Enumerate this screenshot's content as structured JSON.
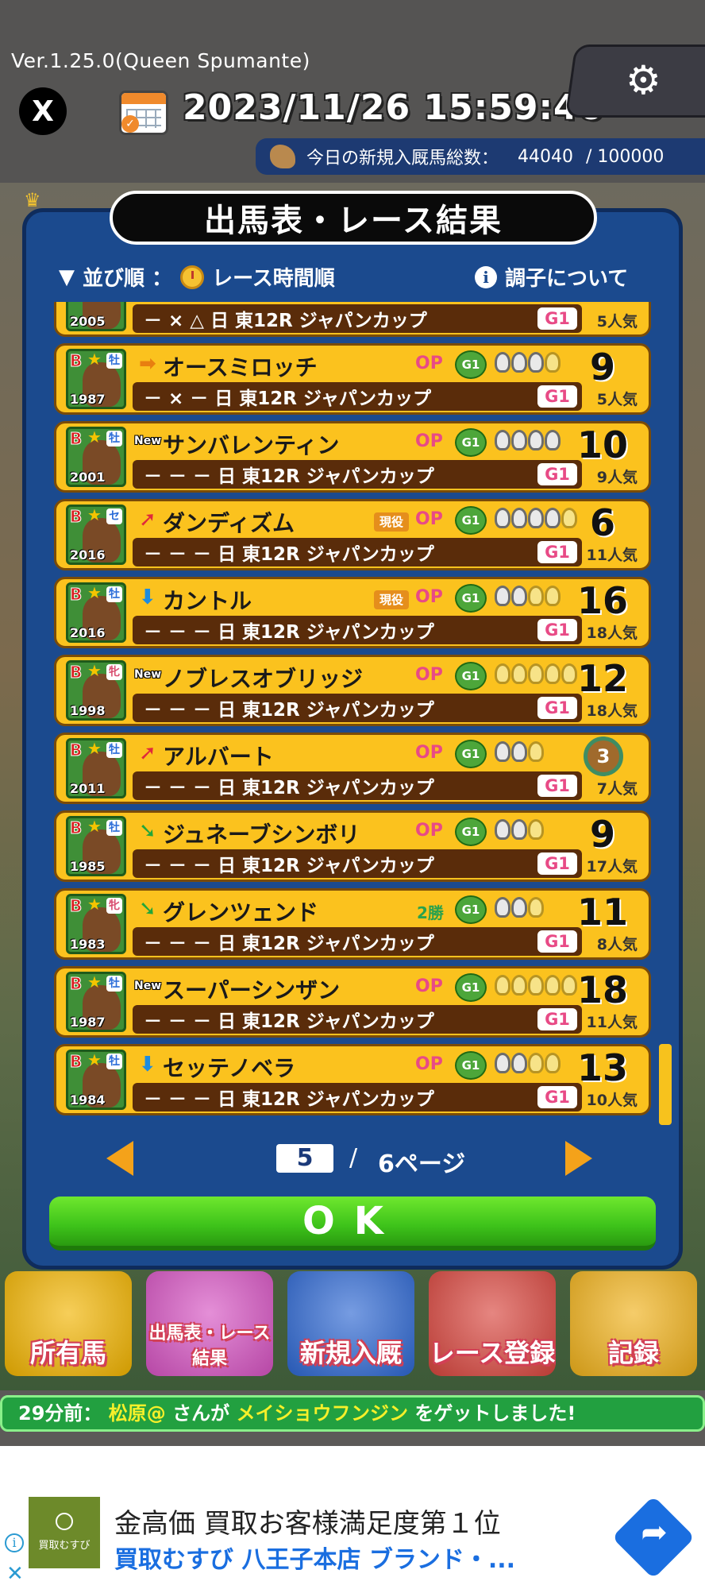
{
  "header": {
    "version": "Ver.1.25.0(Queen Spumante)",
    "x_logo": "X",
    "datetime": "2023/11/26 15:59:46",
    "new_horses_label": "今日の新規入厩馬総数：",
    "new_horses_count": "44040",
    "new_horses_max": "/ 100000"
  },
  "dialog": {
    "title": "出馬表・レース結果",
    "sort_label": "並び順 ：",
    "sort_value": "レース時間順",
    "info_label": "調子について",
    "rows": [
      {
        "grade": "B",
        "sex": "牡",
        "sex_type": "m",
        "year": "2005",
        "trend": "",
        "trend_type": "flat",
        "new": "",
        "name": "",
        "active": "",
        "cls": "",
        "cls_type": "op",
        "shoes_gray": 0,
        "shoes_gold": 0,
        "race": "－ × △ 日 東12R ジャパンカップ",
        "g1": "G1",
        "rank": "",
        "medal": "",
        "pop": "5人気"
      },
      {
        "grade": "B",
        "sex": "牡",
        "sex_type": "m",
        "year": "1987",
        "trend": "➡",
        "trend_type": "flat",
        "new": "",
        "name": "オースミロッチ",
        "active": "",
        "cls": "OP",
        "cls_type": "op",
        "shoes_gray": 3,
        "shoes_gold": 1,
        "race": "－ × － 日 東12R ジャパンカップ",
        "g1": "G1",
        "rank": "9",
        "medal": "",
        "pop": "5人気"
      },
      {
        "grade": "B",
        "sex": "牡",
        "sex_type": "m",
        "year": "2001",
        "trend": "",
        "trend_type": "flat",
        "new": "New",
        "name": "サンバレンティン",
        "active": "",
        "cls": "OP",
        "cls_type": "op",
        "shoes_gray": 4,
        "shoes_gold": 0,
        "race": "－ － － 日 東12R ジャパンカップ",
        "g1": "G1",
        "rank": "10",
        "medal": "",
        "pop": "9人気"
      },
      {
        "grade": "B",
        "sex": "セ",
        "sex_type": "m",
        "year": "2016",
        "trend": "➚",
        "trend_type": "up",
        "new": "",
        "name": "ダンディズム",
        "active": "現役",
        "cls": "OP",
        "cls_type": "op",
        "shoes_gray": 4,
        "shoes_gold": 1,
        "race": "－ － － 日 東12R ジャパンカップ",
        "g1": "G1",
        "rank": "6",
        "medal": "",
        "pop": "11人気"
      },
      {
        "grade": "B",
        "sex": "牡",
        "sex_type": "m",
        "year": "2016",
        "trend": "⬇",
        "trend_type": "down",
        "new": "",
        "name": "カントル",
        "active": "現役",
        "cls": "OP",
        "cls_type": "op",
        "shoes_gray": 2,
        "shoes_gold": 2,
        "race": "－ － － 日 東12R ジャパンカップ",
        "g1": "G1",
        "rank": "16",
        "medal": "",
        "pop": "18人気"
      },
      {
        "grade": "B",
        "sex": "牝",
        "sex_type": "f",
        "year": "1998",
        "trend": "",
        "trend_type": "flat",
        "new": "New",
        "name": "ノブレスオブリッジ",
        "active": "",
        "cls": "OP",
        "cls_type": "op",
        "shoes_gray": 0,
        "shoes_gold": 5,
        "race": "－ － － 日 東12R ジャパンカップ",
        "g1": "G1",
        "rank": "12",
        "medal": "",
        "pop": "18人気"
      },
      {
        "grade": "B",
        "sex": "牡",
        "sex_type": "m",
        "year": "2011",
        "trend": "➚",
        "trend_type": "up",
        "new": "",
        "name": "アルバート",
        "active": "",
        "cls": "OP",
        "cls_type": "op",
        "shoes_gray": 2,
        "shoes_gold": 1,
        "race": "－ － － 日 東12R ジャパンカップ",
        "g1": "G1",
        "rank": "",
        "medal": "3",
        "pop": "7人気"
      },
      {
        "grade": "B",
        "sex": "牡",
        "sex_type": "m",
        "year": "1985",
        "trend": "➘",
        "trend_type": "diag",
        "new": "",
        "name": "ジュネーブシンボリ",
        "active": "",
        "cls": "OP",
        "cls_type": "op",
        "shoes_gray": 2,
        "shoes_gold": 1,
        "race": "－ － － 日 東12R ジャパンカップ",
        "g1": "G1",
        "rank": "9",
        "medal": "",
        "pop": "17人気"
      },
      {
        "grade": "B",
        "sex": "牝",
        "sex_type": "f",
        "year": "1983",
        "trend": "➘",
        "trend_type": "diag",
        "new": "",
        "name": "グレンツェンド",
        "active": "",
        "cls": "2勝",
        "cls_type": "win",
        "shoes_gray": 2,
        "shoes_gold": 1,
        "race": "－ － － 日 東12R ジャパンカップ",
        "g1": "G1",
        "rank": "11",
        "medal": "",
        "pop": "8人気"
      },
      {
        "grade": "B",
        "sex": "牡",
        "sex_type": "m",
        "year": "1987",
        "trend": "",
        "trend_type": "flat",
        "new": "New",
        "name": "スーパーシンザン",
        "active": "",
        "cls": "OP",
        "cls_type": "op",
        "shoes_gray": 0,
        "shoes_gold": 5,
        "race": "－ － － 日 東12R ジャパンカップ",
        "g1": "G1",
        "rank": "18",
        "medal": "",
        "pop": "11人気"
      },
      {
        "grade": "B",
        "sex": "牡",
        "sex_type": "m",
        "year": "1984",
        "trend": "⬇",
        "trend_type": "down",
        "new": "",
        "name": "セッテノベラ",
        "active": "",
        "cls": "OP",
        "cls_type": "op",
        "shoes_gray": 2,
        "shoes_gold": 2,
        "race": "－ － － 日 東12R ジャパンカップ",
        "g1": "G1",
        "rank": "13",
        "medal": "",
        "pop": "10人気"
      }
    ],
    "g1_badge": "G1",
    "pager": {
      "current": "5",
      "slash": "/",
      "total": "6ページ"
    },
    "ok_label": "OK"
  },
  "nav": [
    {
      "label": "所有馬",
      "color": "#f2b400"
    },
    {
      "label": "出馬表・レース結果",
      "color": "#d653c2"
    },
    {
      "label": "新規入厩",
      "color": "#2d67d2"
    },
    {
      "label": "レース登録",
      "color": "#d8453d"
    },
    {
      "label": "記録",
      "color": "#f0b11a"
    }
  ],
  "ticker": {
    "time": "29分前：",
    "user": "松原@",
    "mid": "さんが",
    "horse": "メイショウフンジン",
    "end": "をゲットしました!"
  },
  "ad": {
    "logo_text": "買取むすび",
    "line1": "金高価 買取お客様満足度第１位",
    "line2": "買取むすび 八王子本店 ブランド・...",
    "info": "i",
    "close": "✕"
  },
  "colors": {
    "dialog_bg": "#1b4a8e",
    "card_bg": "#fbc21e",
    "race_bar": "#5a2c0a",
    "ok_green": "#3dc21a"
  }
}
